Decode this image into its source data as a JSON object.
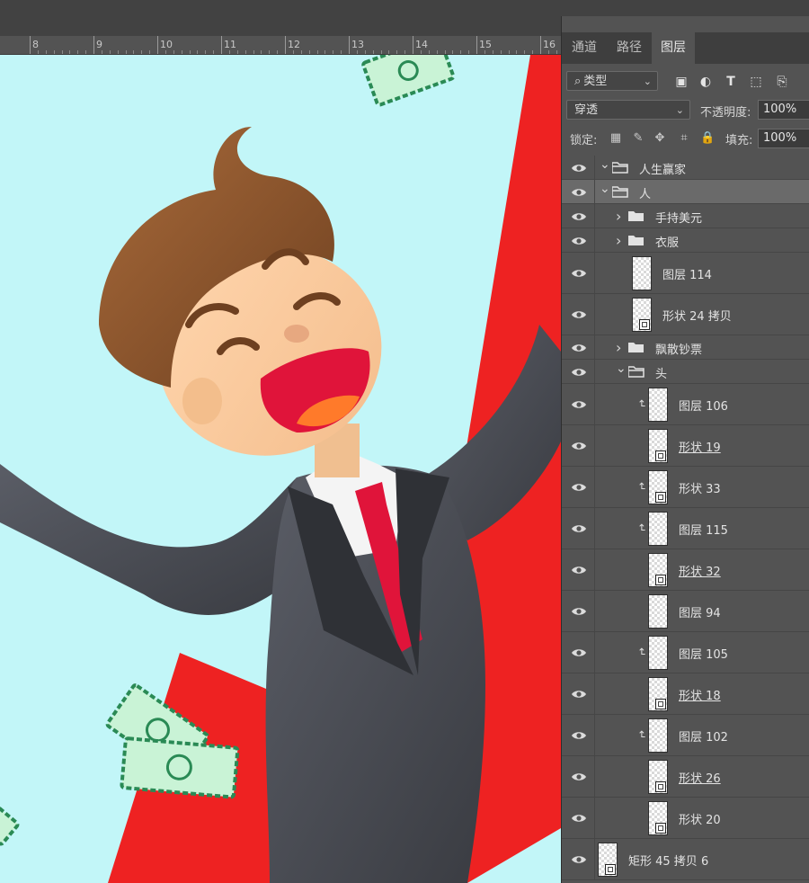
{
  "ruler": {
    "numbers": [
      "8",
      "9",
      "10",
      "11",
      "12",
      "13",
      "14",
      "15",
      "16"
    ]
  },
  "panel": {
    "tabs": [
      {
        "label": "通道",
        "active": false
      },
      {
        "label": "路径",
        "active": false
      },
      {
        "label": "图层",
        "active": true
      }
    ],
    "filter": {
      "label": "类型",
      "search_icon": "search-icon"
    },
    "blend_mode": "穿透",
    "opacity_label": "不透明度:",
    "opacity_value": "100%",
    "lock_label": "锁定:",
    "fill_label": "填充:",
    "fill_value": "100%",
    "layers": [
      {
        "name": "人生赢家",
        "kind": "group",
        "expanded": true,
        "indent": 0,
        "selected": false
      },
      {
        "name": "人",
        "kind": "group",
        "expanded": true,
        "indent": 0,
        "selected": true
      },
      {
        "name": "手持美元",
        "kind": "group",
        "expanded": false,
        "indent": 1,
        "selected": false
      },
      {
        "name": "衣服",
        "kind": "group",
        "expanded": false,
        "indent": 1,
        "selected": false
      },
      {
        "name": "图层 114",
        "kind": "layer",
        "indent": 1,
        "clip": false,
        "shape": false,
        "underline": false
      },
      {
        "name": "形状 24 拷贝",
        "kind": "layer",
        "indent": 1,
        "clip": false,
        "shape": true,
        "underline": false
      },
      {
        "name": "飘散钞票",
        "kind": "group",
        "expanded": false,
        "indent": 1,
        "selected": false
      },
      {
        "name": "头",
        "kind": "group",
        "expanded": true,
        "indent": 1,
        "selected": false
      },
      {
        "name": "图层 106",
        "kind": "layer",
        "indent": 2,
        "clip": true,
        "shape": false,
        "underline": false
      },
      {
        "name": "形状 19",
        "kind": "layer",
        "indent": 2,
        "clip": false,
        "shape": true,
        "underline": true
      },
      {
        "name": "形状 33",
        "kind": "layer",
        "indent": 2,
        "clip": true,
        "shape": true,
        "underline": false
      },
      {
        "name": "图层 115",
        "kind": "layer",
        "indent": 2,
        "clip": true,
        "shape": false,
        "underline": false
      },
      {
        "name": "形状 32",
        "kind": "layer",
        "indent": 2,
        "clip": false,
        "shape": true,
        "underline": true
      },
      {
        "name": "图层 94",
        "kind": "layer",
        "indent": 2,
        "clip": false,
        "shape": false,
        "underline": false
      },
      {
        "name": "图层 105",
        "kind": "layer",
        "indent": 2,
        "clip": true,
        "shape": false,
        "underline": false
      },
      {
        "name": "形状 18",
        "kind": "layer",
        "indent": 2,
        "clip": false,
        "shape": true,
        "underline": true
      },
      {
        "name": "图层 102",
        "kind": "layer",
        "indent": 2,
        "clip": true,
        "shape": false,
        "underline": false
      },
      {
        "name": "形状 26",
        "kind": "layer",
        "indent": 2,
        "clip": false,
        "shape": true,
        "underline": true
      },
      {
        "name": "形状 20",
        "kind": "layer",
        "indent": 2,
        "clip": false,
        "shape": true,
        "underline": false
      },
      {
        "name": "矩形 45 拷贝 6",
        "kind": "layer",
        "indent": 0,
        "clip": false,
        "shape": true,
        "underline": false
      }
    ]
  },
  "colors": {
    "canvas_bg": "#c2f6f8",
    "arrow_red": "#ee2222",
    "panel_bg": "#535353"
  }
}
